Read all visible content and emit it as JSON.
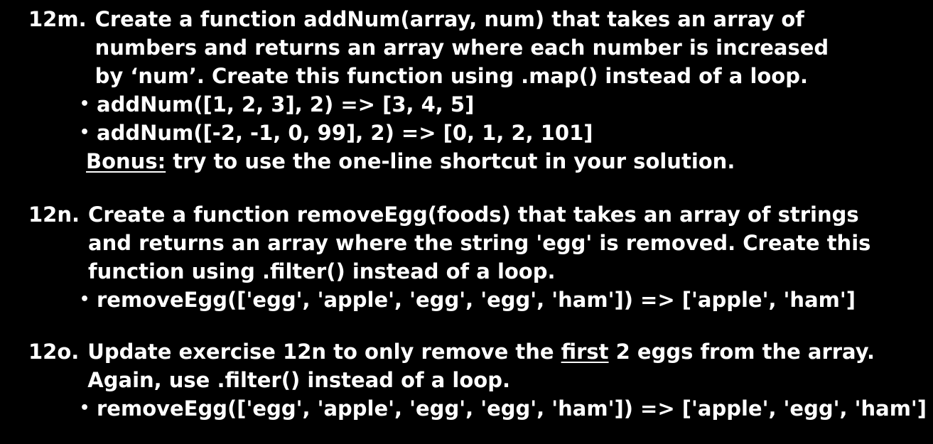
{
  "exercises": {
    "m": {
      "number": "12m.",
      "line1": "Create a function addNum(array, num) that takes an array of",
      "line2": "numbers and returns an array where each number is increased",
      "line3": "by ‘num’. Create this function using .map() instead of a loop.",
      "bullets": [
        "addNum([1, 2, 3], 2) => [3, 4, 5]",
        "addNum([-2, -1, 0, 99], 2) => [0, 1, 2, 101]"
      ],
      "bonus_label": "Bonus:",
      "bonus_text": " try to use the one-line shortcut in your solution."
    },
    "n": {
      "number": "12n.",
      "line1": "Create a function removeEgg(foods) that takes an array of strings",
      "line2": "and returns an array where the string 'egg' is removed. Create this",
      "line3": "function using .filter() instead of a loop.",
      "bullets": [
        "removeEgg(['egg', 'apple', 'egg', 'egg', 'ham']) => ['apple', 'ham']"
      ]
    },
    "o": {
      "number": "12o.",
      "line1_before": "Update exercise 12n to only remove the ",
      "line1_underlined": "first",
      "line1_after": " 2 eggs from the array.",
      "line2": "Again, use .filter() instead of a loop.",
      "bullets": [
        "removeEgg(['egg', 'apple', 'egg', 'egg', 'ham']) => ['apple', 'egg', 'ham']"
      ]
    }
  },
  "bullet_glyph": "•"
}
